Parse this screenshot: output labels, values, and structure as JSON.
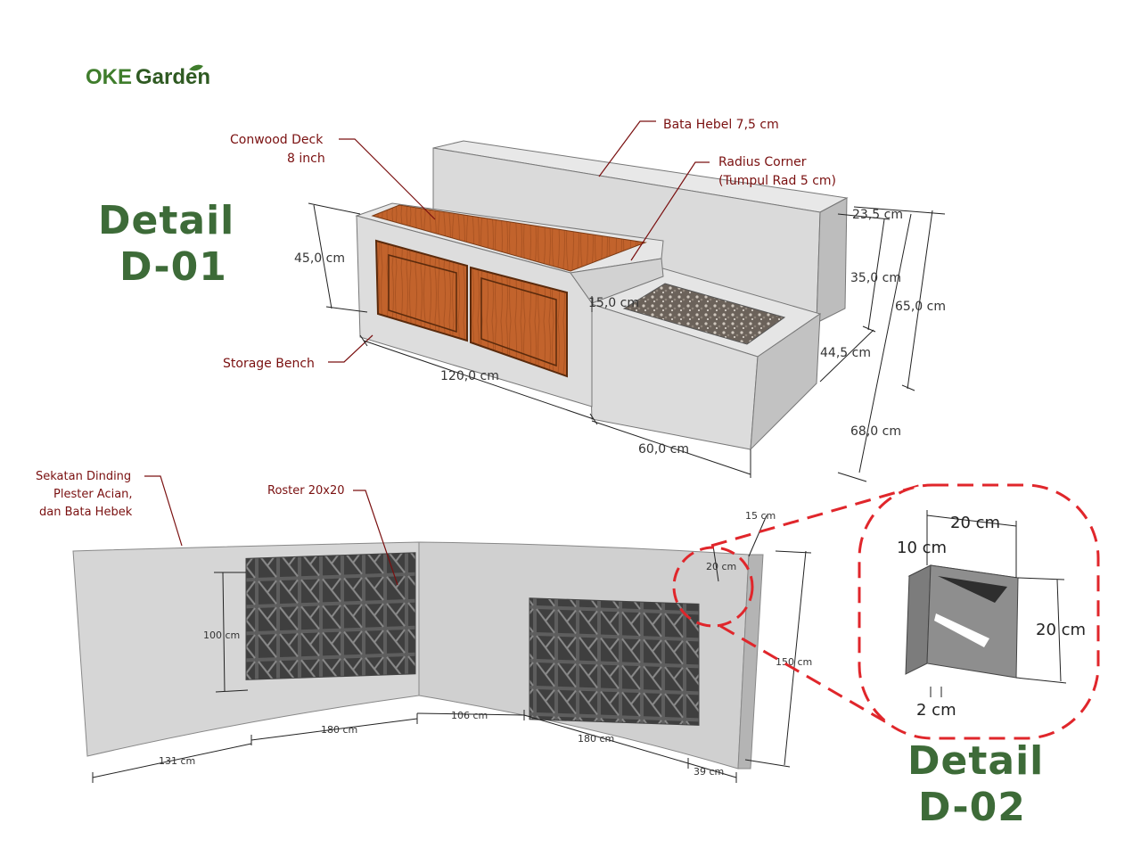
{
  "brand": {
    "name_a": "OKE",
    "name_b": "Garden"
  },
  "detail_d01": {
    "line1": "Detail",
    "line2": "D-01"
  },
  "detail_d02": {
    "line1": "Detail",
    "line2": "D-02"
  },
  "bench_labels": {
    "conwood_1": "Conwood Deck",
    "conwood_2": "8 inch",
    "bata_hebel": "Bata Hebel 7,5 cm",
    "radius_1": "Radius Corner",
    "radius_2": "(Tumpul Rad 5 cm)",
    "storage": "Storage Bench"
  },
  "bench_dims": {
    "h45": "45,0 cm",
    "w120": "120,0 cm",
    "h15": "15,0 cm",
    "w60": "60,0 cm",
    "d23": "23,5 cm",
    "h35": "35,0 cm",
    "h65": "65,0 cm",
    "d44": "44,5 cm",
    "d68": "68,0 cm"
  },
  "wall_labels": {
    "sekatan_1": "Sekatan Dinding",
    "sekatan_2": "Plester Acian,",
    "sekatan_3": "dan Bata Hebek",
    "roster": "Roster 20x20"
  },
  "wall_dims": {
    "h100": "100 cm",
    "w180a": "180 cm",
    "w106": "106 cm",
    "w180b": "180 cm",
    "w131": "131 cm",
    "w39": "39 cm",
    "h150": "150 cm",
    "t15": "15 cm",
    "s20": "20 cm"
  },
  "roster_dims": {
    "w20": "20 cm",
    "d10": "10 cm",
    "h20": "20 cm",
    "t2": "2 cm"
  },
  "colors": {
    "detail_green": "#3d6b38",
    "label_red": "#7a1010",
    "callout_red": "#e0262b",
    "wood": "#c2632c",
    "concrete": "#d9d9d9"
  }
}
